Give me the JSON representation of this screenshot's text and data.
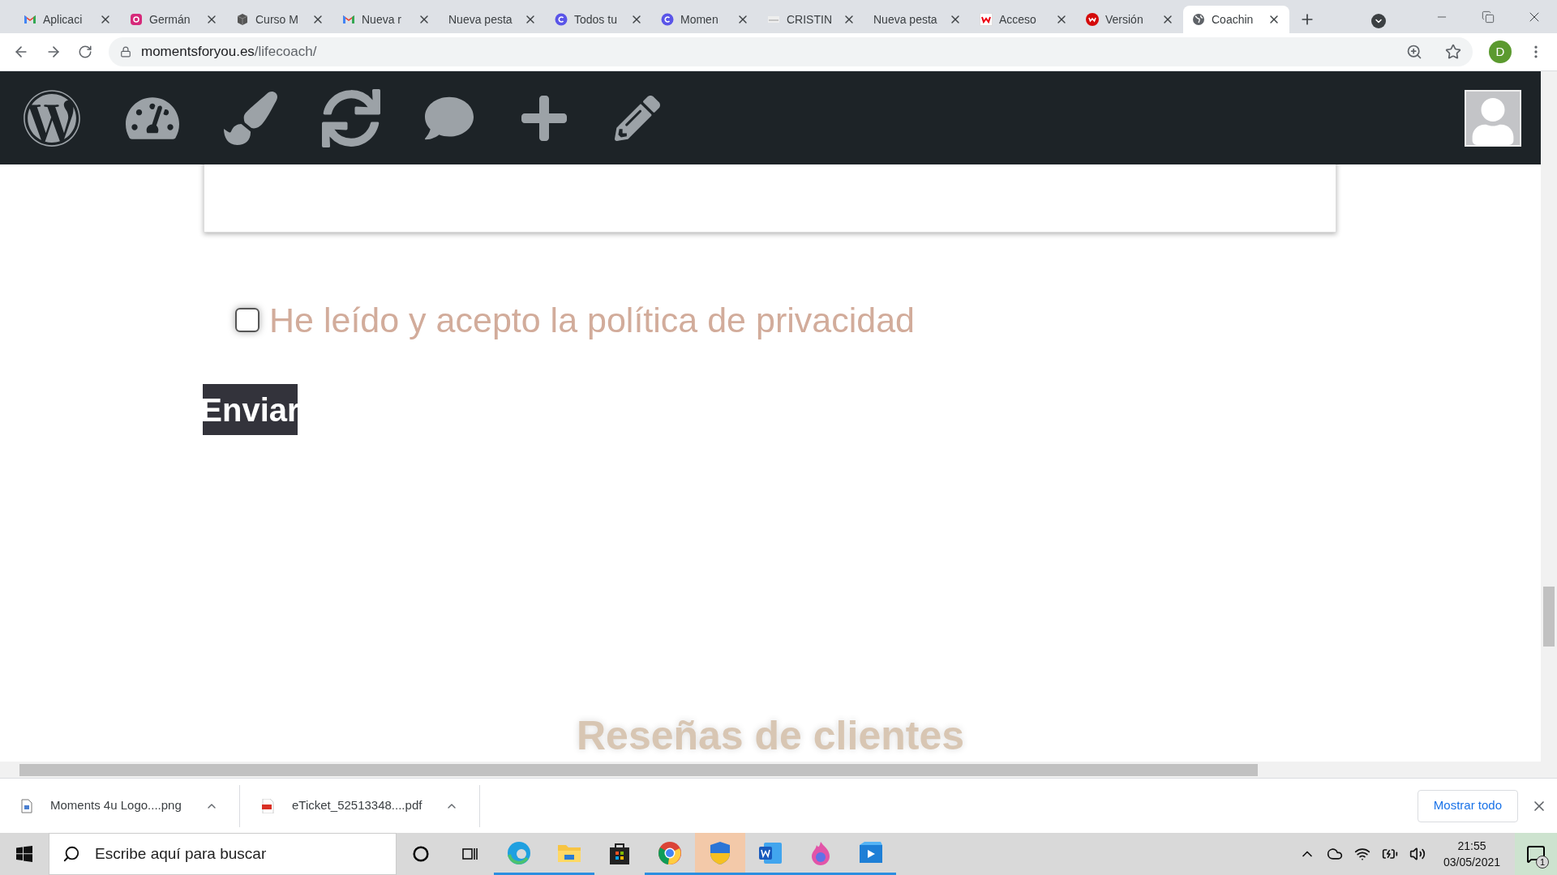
{
  "browser": {
    "tabs": [
      {
        "title": "Aplicaci",
        "kind": "mail",
        "selected": false
      },
      {
        "title": "Germán",
        "kind": "camera",
        "selected": false
      },
      {
        "title": "Curso M",
        "kind": "cube",
        "selected": false
      },
      {
        "title": "Nueva r",
        "kind": "mail",
        "selected": false
      },
      {
        "title": "Nueva pesta",
        "kind": "plain",
        "selected": false
      },
      {
        "title": "Todos tu",
        "kind": "circle",
        "selected": false
      },
      {
        "title": "Momen",
        "kind": "circle",
        "selected": false
      },
      {
        "title": "CRISTIN",
        "kind": "image",
        "selected": false
      },
      {
        "title": "Nueva pesta",
        "kind": "plain",
        "selected": false
      },
      {
        "title": "Acceso",
        "kind": "square",
        "selected": false
      },
      {
        "title": "Versión",
        "kind": "badge",
        "selected": false
      },
      {
        "title": "Coachin",
        "kind": "globe",
        "selected": true
      }
    ],
    "address": {
      "domain": "momentsforyou.es",
      "path": "/lifecoach/"
    },
    "profile_initial": "D"
  },
  "page": {
    "consent": {
      "label": "He leído y acepto la política de privacidad",
      "checked": false
    },
    "submit_button": "Enviar",
    "section_heading": "Reseñas de clientes"
  },
  "downloads": {
    "items": [
      {
        "name": "Moments 4u Logo....png",
        "kind": "image"
      },
      {
        "name": "eTicket_52513348....pdf",
        "kind": "pdf"
      }
    ],
    "show_all": "Mostrar todo"
  },
  "taskbar": {
    "search_placeholder": "Escribe aquí para buscar",
    "time": "21:55",
    "date": "03/05/2021",
    "notifications": "1"
  }
}
